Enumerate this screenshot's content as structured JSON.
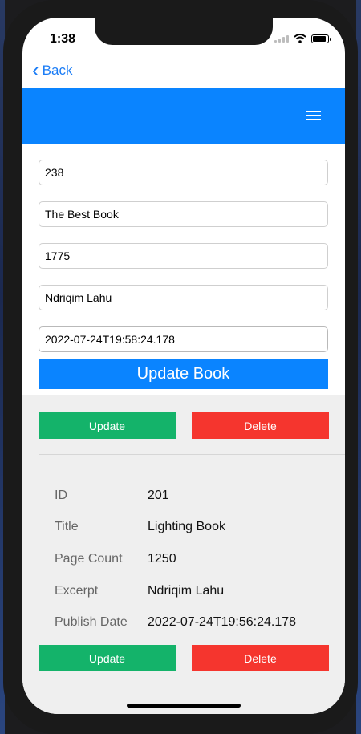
{
  "status": {
    "time": "1:38"
  },
  "nav": {
    "back_label": "Back"
  },
  "form": {
    "id_value": "238",
    "title_value": "The Best Book",
    "page_count_value": "1775",
    "excerpt_value": "Ndriqim Lahu",
    "publish_date_value": "2022-07-24T19:58:24.178",
    "submit_label": "Update Book"
  },
  "actions": {
    "update_label": "Update",
    "delete_label": "Delete"
  },
  "book": {
    "labels": {
      "id": "ID",
      "title": "Title",
      "page_count": "Page Count",
      "excerpt": "Excerpt",
      "publish_date": "Publish Date"
    },
    "id": "201",
    "title": "Lighting Book",
    "page_count": "1250",
    "excerpt": "Ndriqim Lahu",
    "publish_date": "2022-07-24T19:56:24.178"
  },
  "colors": {
    "accent": "#0a84ff",
    "update": "#14b36a",
    "delete": "#f5352e"
  },
  "icons": {
    "menu": "hamburger-icon",
    "back": "chevron-left-icon"
  }
}
